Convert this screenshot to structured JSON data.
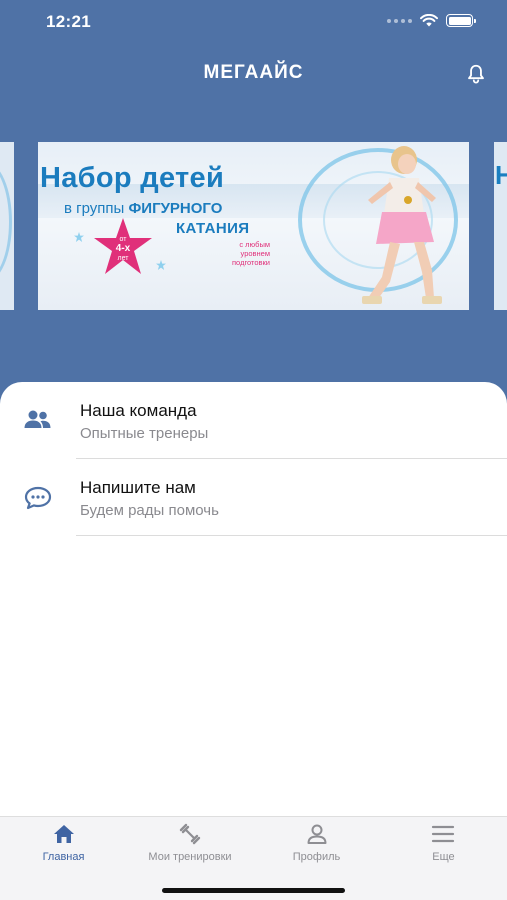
{
  "status_bar": {
    "time": "12:21"
  },
  "header": {
    "title": "МЕГААЙС"
  },
  "banner": {
    "headline": "Набор детей",
    "line2_prefix": "в группы ",
    "line2_bold": "ФИГУРНОГО",
    "line3": "КАТАНИЯ",
    "age_top": "от",
    "age_main": "4-х",
    "age_bottom": "лет",
    "small_line1": "с любым",
    "small_line2": "уровнем подготовки",
    "right_card_fragment": "Н"
  },
  "menu": {
    "items": [
      {
        "title": "Наша команда",
        "subtitle": "Опытные тренеры",
        "icon": "people-icon"
      },
      {
        "title": "Напишите нам",
        "subtitle": "Будем рады помочь",
        "icon": "chat-bubble-icon"
      }
    ]
  },
  "tabbar": {
    "tabs": [
      {
        "label": "Главная",
        "icon": "home-icon",
        "active": true
      },
      {
        "label": "Мои тренировки",
        "icon": "dumbbell-icon",
        "active": false
      },
      {
        "label": "Профиль",
        "icon": "person-icon",
        "active": false
      },
      {
        "label": "Еще",
        "icon": "menu-icon",
        "active": false
      }
    ]
  },
  "colors": {
    "brand": "#4f72a6",
    "tab_active": "#3f64a3",
    "tab_inactive": "#8e8e93",
    "banner_blue": "#1b7cbe",
    "banner_pink": "#e0307a"
  }
}
